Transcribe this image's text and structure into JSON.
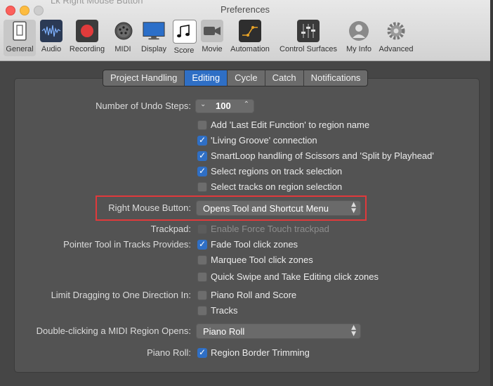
{
  "window": {
    "title": "Preferences",
    "ghost_text": "Lk Right Mouse Button"
  },
  "toolbar": {
    "items": [
      {
        "label": "General",
        "icon": "general-icon",
        "selected": true
      },
      {
        "label": "Audio",
        "icon": "audio-waveform-icon"
      },
      {
        "label": "Recording",
        "icon": "record-icon"
      },
      {
        "label": "MIDI",
        "icon": "midi-connector-icon"
      },
      {
        "label": "Display",
        "icon": "display-monitor-icon"
      },
      {
        "label": "Score",
        "icon": "score-notes-icon"
      },
      {
        "label": "Movie",
        "icon": "movie-camera-icon"
      },
      {
        "label": "Automation",
        "icon": "automation-curve-icon"
      },
      {
        "label": "Control Surfaces",
        "icon": "control-surface-faders-icon"
      },
      {
        "label": "My Info",
        "icon": "user-silhouette-icon"
      },
      {
        "label": "Advanced",
        "icon": "gear-icon"
      }
    ]
  },
  "tabs": [
    {
      "label": "Project Handling"
    },
    {
      "label": "Editing",
      "active": true
    },
    {
      "label": "Cycle"
    },
    {
      "label": "Catch"
    },
    {
      "label": "Notifications"
    }
  ],
  "editing": {
    "undo_label": "Number of Undo Steps:",
    "undo_value": "100",
    "checks": [
      {
        "label": "Add 'Last Edit Function' to region name",
        "checked": false
      },
      {
        "label": "'Living Groove' connection",
        "checked": true
      },
      {
        "label": "SmartLoop handling of Scissors and 'Split by Playhead'",
        "checked": true
      },
      {
        "label": "Select regions on track selection",
        "checked": true
      },
      {
        "label": "Select tracks on region selection",
        "checked": false
      }
    ],
    "right_mouse_label": "Right Mouse Button:",
    "right_mouse_value": "Opens Tool and Shortcut Menu",
    "trackpad_label": "Trackpad:",
    "trackpad_check": "Enable Force Touch trackpad",
    "pointer_label": "Pointer Tool in Tracks Provides:",
    "pointer_checks": [
      {
        "label": "Fade Tool click zones",
        "checked": true
      },
      {
        "label": "Marquee Tool click zones",
        "checked": false
      },
      {
        "label": "Quick Swipe and Take Editing click zones",
        "checked": false
      }
    ],
    "limit_label": "Limit Dragging to One Direction In:",
    "limit_checks": [
      {
        "label": "Piano Roll and Score",
        "checked": false
      },
      {
        "label": "Tracks",
        "checked": false
      }
    ],
    "double_click_label": "Double-clicking a MIDI Region Opens:",
    "double_click_value": "Piano Roll",
    "piano_roll_label": "Piano Roll:",
    "piano_roll_check": "Region Border Trimming",
    "piano_roll_checked": true
  },
  "colors": {
    "accent": "#2f6fc5",
    "highlight_box": "#e0393b"
  }
}
